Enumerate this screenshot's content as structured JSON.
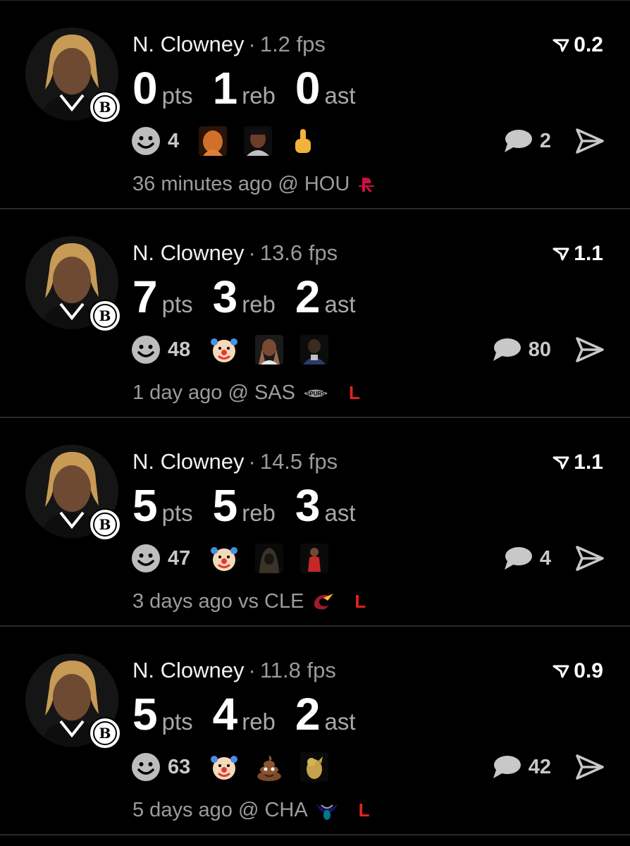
{
  "feed": {
    "posts": [
      {
        "player": "N. Clowney",
        "fps": "1.2 fps",
        "rating": "0.2",
        "stats": [
          {
            "value": "0",
            "unit": "pts"
          },
          {
            "value": "1",
            "unit": "reb"
          },
          {
            "value": "0",
            "unit": "ast"
          }
        ],
        "reaction_count": "4",
        "comment_count": "2",
        "meta": "36 minutes ago @ HOU",
        "result": ""
      },
      {
        "player": "N. Clowney",
        "fps": "13.6 fps",
        "rating": "1.1",
        "stats": [
          {
            "value": "7",
            "unit": "pts"
          },
          {
            "value": "3",
            "unit": "reb"
          },
          {
            "value": "2",
            "unit": "ast"
          }
        ],
        "reaction_count": "48",
        "comment_count": "80",
        "meta": "1 day ago @ SAS",
        "result": "L"
      },
      {
        "player": "N. Clowney",
        "fps": "14.5 fps",
        "rating": "1.1",
        "stats": [
          {
            "value": "5",
            "unit": "pts"
          },
          {
            "value": "5",
            "unit": "reb"
          },
          {
            "value": "3",
            "unit": "ast"
          }
        ],
        "reaction_count": "47",
        "comment_count": "4",
        "meta": "3 days ago vs CLE",
        "result": "L"
      },
      {
        "player": "N. Clowney",
        "fps": "11.8 fps",
        "rating": "0.9",
        "stats": [
          {
            "value": "5",
            "unit": "pts"
          },
          {
            "value": "4",
            "unit": "reb"
          },
          {
            "value": "2",
            "unit": "ast"
          }
        ],
        "reaction_count": "63",
        "comment_count": "42",
        "meta": "5 days ago @ CHA",
        "result": "L"
      }
    ]
  },
  "icons": {
    "rating": "rating-chevron-icon",
    "reaction": "smile-icon",
    "comment": "comment-bubble-icon",
    "share": "send-icon",
    "team_badge": "nets-logo-icon"
  },
  "colors": {
    "background": "#000000",
    "loss": "#e0251b",
    "muted_text": "#9c9c9c",
    "divider": "#2a2a2a"
  }
}
